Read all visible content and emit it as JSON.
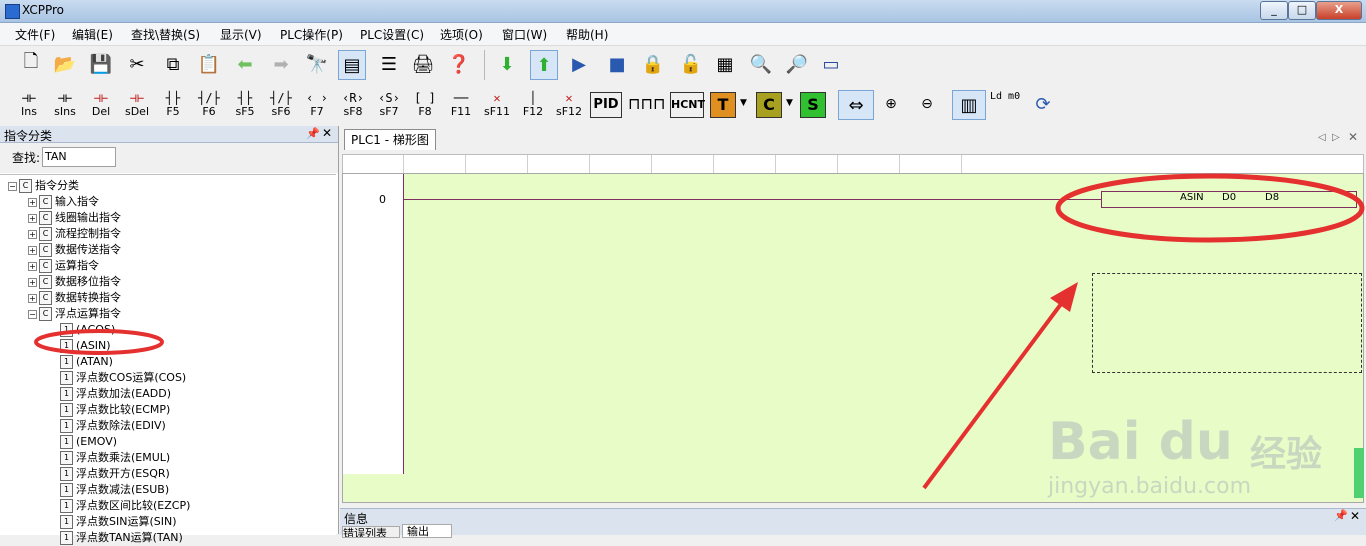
{
  "window": {
    "title": "XCPPro",
    "min": "_",
    "max": "□",
    "close": "X"
  },
  "menu": [
    "文件(F)",
    "编辑(E)",
    "查找\\替换(S)",
    "显示(V)",
    "PLC操作(P)",
    "PLC设置(C)",
    "选项(O)",
    "窗口(W)",
    "帮助(H)"
  ],
  "toolbar2": {
    "items": [
      {
        "glyph": "⊣⊢",
        "label": "Ins"
      },
      {
        "glyph": "⊣⊢",
        "label": "sIns"
      },
      {
        "glyph": "⊣⊢",
        "label": "Del"
      },
      {
        "glyph": "⊣⊢",
        "label": "sDel"
      },
      {
        "glyph": "┤├",
        "label": "F5"
      },
      {
        "glyph": "┤/├",
        "label": "F6"
      },
      {
        "glyph": "┤├",
        "label": "sF5"
      },
      {
        "glyph": "┤/├",
        "label": "sF6"
      },
      {
        "glyph": "‹ ›",
        "label": "F7"
      },
      {
        "glyph": "‹R›",
        "label": "sF8"
      },
      {
        "glyph": "‹S›",
        "label": "sF7"
      },
      {
        "glyph": "[ ]",
        "label": "F8"
      },
      {
        "glyph": "──",
        "label": "F11"
      },
      {
        "glyph": "✕",
        "label": "sF11"
      },
      {
        "glyph": "│",
        "label": "F12"
      },
      {
        "glyph": "✕",
        "label": "sF12"
      }
    ],
    "pid": "PID",
    "hcnt": "HCNT",
    "t": "T",
    "c": "C",
    "s": "S",
    "ld": "Ld m0"
  },
  "left_panel": {
    "title": "指令分类",
    "search_label": "查找:",
    "search_value": "TAN",
    "tree": [
      {
        "label": "指令分类",
        "level": 0,
        "expanded": true
      },
      {
        "label": "输入指令",
        "level": 1
      },
      {
        "label": "线圈输出指令",
        "level": 1
      },
      {
        "label": "流程控制指令",
        "level": 1
      },
      {
        "label": "数据传送指令",
        "level": 1
      },
      {
        "label": "运算指令",
        "level": 1
      },
      {
        "label": "数据移位指令",
        "level": 1
      },
      {
        "label": "数据转换指令",
        "level": 1
      },
      {
        "label": "浮点运算指令",
        "level": 1,
        "expanded": true
      },
      {
        "label": "(ACOS)",
        "level": 2
      },
      {
        "label": "(ASIN)",
        "level": 2
      },
      {
        "label": "(ATAN)",
        "level": 2
      },
      {
        "label": "浮点数COS运算(COS)",
        "level": 2
      },
      {
        "label": "浮点数加法(EADD)",
        "level": 2
      },
      {
        "label": "浮点数比较(ECMP)",
        "level": 2
      },
      {
        "label": "浮点数除法(EDIV)",
        "level": 2
      },
      {
        "label": "(EMOV)",
        "level": 2
      },
      {
        "label": "浮点数乘法(EMUL)",
        "level": 2
      },
      {
        "label": "浮点数开方(ESQR)",
        "level": 2
      },
      {
        "label": "浮点数减法(ESUB)",
        "level": 2
      },
      {
        "label": "浮点数区间比较(EZCP)",
        "level": 2
      },
      {
        "label": "浮点数SIN运算(SIN)",
        "level": 2
      },
      {
        "label": "浮点数TAN运算(TAN)",
        "level": 2
      }
    ]
  },
  "editor": {
    "tab": "PLC1 - 梯形图",
    "rung_number": "0",
    "instruction": {
      "op": "ASIN",
      "src": "D0",
      "dst": "D8"
    }
  },
  "info_panel": {
    "title": "信息",
    "tabs": [
      "错误列表",
      "输出"
    ]
  },
  "watermark": {
    "brand": "Bai  du",
    "cn": "经验",
    "url": "jingyan.baidu.com"
  },
  "colors": {
    "annotation": "#e53030",
    "ladder_bg": "#e8fcc8",
    "rung": "#803060"
  }
}
